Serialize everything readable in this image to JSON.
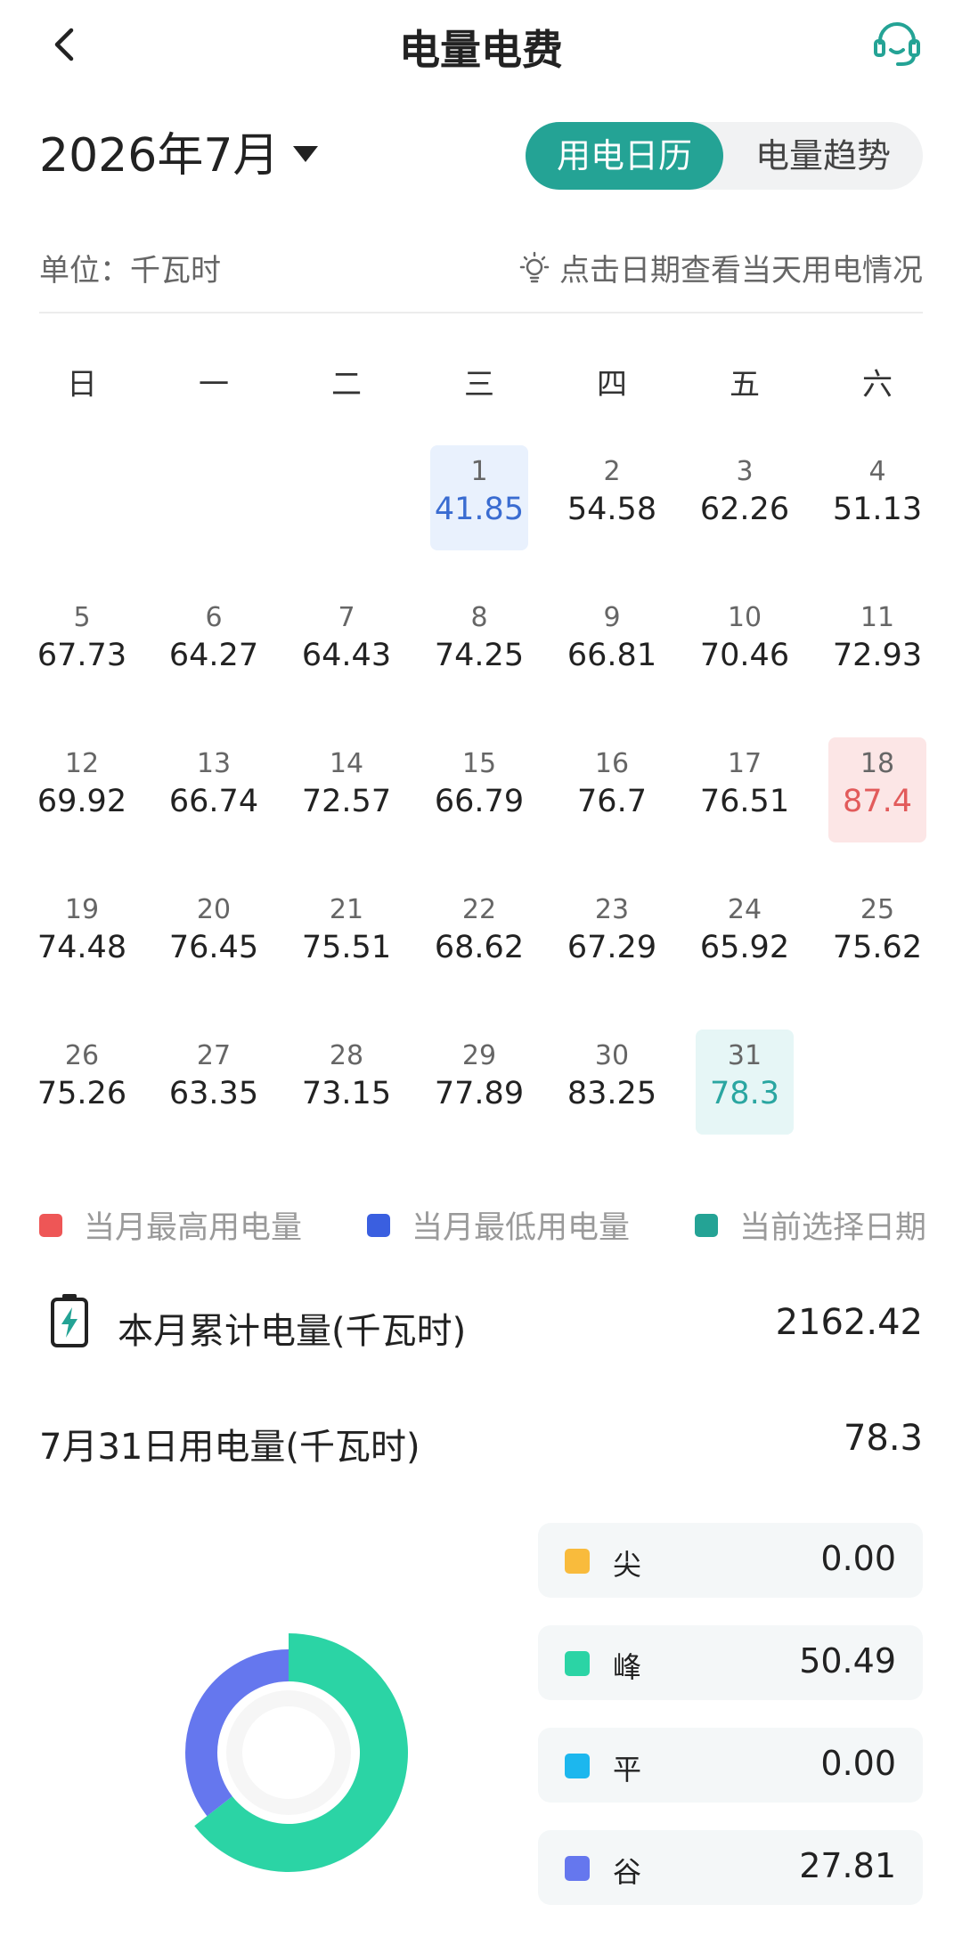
{
  "header": {
    "title": "电量电费",
    "back_icon": "chevron-left-icon",
    "service_icon": "headset-icon"
  },
  "month": {
    "label": "2026年7月"
  },
  "tabs": [
    {
      "label": "用电日历",
      "active": true
    },
    {
      "label": "电量趋势",
      "active": false
    }
  ],
  "unit_label": "单位：千瓦时",
  "hint": {
    "text": "点击日期查看当天用电情况",
    "icon": "lightbulb-icon"
  },
  "weekdays": [
    "日",
    "一",
    "二",
    "三",
    "四",
    "五",
    "六"
  ],
  "days": [
    {
      "day": "1",
      "value": "41.85",
      "tag": "low"
    },
    {
      "day": "2",
      "value": "54.58"
    },
    {
      "day": "3",
      "value": "62.26"
    },
    {
      "day": "4",
      "value": "51.13"
    },
    {
      "day": "5",
      "value": "67.73"
    },
    {
      "day": "6",
      "value": "64.27"
    },
    {
      "day": "7",
      "value": "64.43"
    },
    {
      "day": "8",
      "value": "74.25"
    },
    {
      "day": "9",
      "value": "66.81"
    },
    {
      "day": "10",
      "value": "70.46"
    },
    {
      "day": "11",
      "value": "72.93"
    },
    {
      "day": "12",
      "value": "69.92"
    },
    {
      "day": "13",
      "value": "66.74"
    },
    {
      "day": "14",
      "value": "72.57"
    },
    {
      "day": "15",
      "value": "66.79"
    },
    {
      "day": "16",
      "value": "76.7"
    },
    {
      "day": "17",
      "value": "76.51"
    },
    {
      "day": "18",
      "value": "87.4",
      "tag": "high"
    },
    {
      "day": "19",
      "value": "74.48"
    },
    {
      "day": "20",
      "value": "76.45"
    },
    {
      "day": "21",
      "value": "75.51"
    },
    {
      "day": "22",
      "value": "68.62"
    },
    {
      "day": "23",
      "value": "67.29"
    },
    {
      "day": "24",
      "value": "65.92"
    },
    {
      "day": "25",
      "value": "75.62"
    },
    {
      "day": "26",
      "value": "75.26"
    },
    {
      "day": "27",
      "value": "63.35"
    },
    {
      "day": "28",
      "value": "73.15"
    },
    {
      "day": "29",
      "value": "77.89"
    },
    {
      "day": "30",
      "value": "83.25"
    },
    {
      "day": "31",
      "value": "78.3",
      "tag": "selected"
    }
  ],
  "legend": [
    {
      "label": "当月最高用电量",
      "color": "#ee5656"
    },
    {
      "label": "当月最低用电量",
      "color": "#3a5fe0"
    },
    {
      "label": "当前选择日期",
      "color": "#24a395"
    }
  ],
  "monthly_total": {
    "label": "本月累计电量(千瓦时)",
    "value": "2162.42",
    "icon": "battery-charging-icon"
  },
  "daily_total": {
    "label": "7月31日用电量(千瓦时)",
    "value": "78.3"
  },
  "tariffs": [
    {
      "label": "尖",
      "value": "0.00",
      "color": "#f9bb3c"
    },
    {
      "label": "峰",
      "value": "50.49",
      "color": "#2bd4a5"
    },
    {
      "label": "平",
      "value": "0.00",
      "color": "#1cb7ee"
    },
    {
      "label": "谷",
      "value": "27.81",
      "color": "#6577ee"
    }
  ]
}
